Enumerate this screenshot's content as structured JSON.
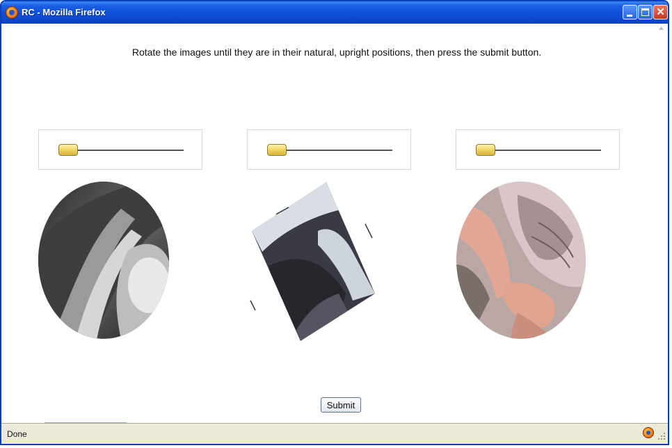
{
  "window": {
    "title": "RC - Mozilla Firefox",
    "controls": [
      "minimize",
      "maximize",
      "close"
    ],
    "colors": {
      "titlebar": "#0f4fd8",
      "border": "#0a3fb5",
      "close": "#c5391b"
    }
  },
  "page": {
    "instructions": "Rotate the images until they are in their natural, upright positions, then press the submit button.",
    "submit_label": "Submit",
    "items": [
      {
        "slider_value": 0,
        "image": "black-and-white landscape photo, rotated"
      },
      {
        "slider_value": 0,
        "image": "dark landscape with snow, rotated"
      },
      {
        "slider_value": 0,
        "image": "person photo, rotated"
      }
    ],
    "colors": {
      "slider_thumb": "#e5c24c",
      "slider_track": "#555555"
    }
  },
  "statusbar": {
    "text": "Done",
    "icons": [
      "firefox-icon",
      "resize-grip-icon"
    ]
  }
}
